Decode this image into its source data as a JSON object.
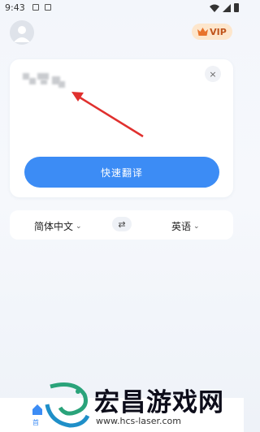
{
  "status_bar": {
    "time": "9:43"
  },
  "header": {
    "vip_label": "VIP"
  },
  "input_card": {
    "close_symbol": "×",
    "translate_label": "快速翻译"
  },
  "language_bar": {
    "source_language": "简体中文",
    "target_language": "英语",
    "swap_symbol": "⇄"
  },
  "nav": {
    "home_label": "首"
  },
  "watermark": {
    "brand_text": "宏昌游戏网",
    "url": "www.hcs-laser.com"
  },
  "colors": {
    "primary": "#3c8cf5",
    "vip_bg": "#fde6cc",
    "vip_text": "#c0541c",
    "annotation_arrow": "#e0302e"
  }
}
